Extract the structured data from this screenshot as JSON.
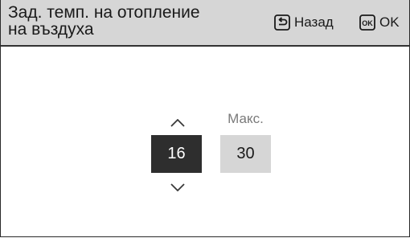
{
  "header": {
    "title_line1": "Зад. темп. на отопление",
    "title_line2": "на въздуха",
    "back_label": "Назад",
    "ok_label": "OK",
    "back_icon": "back-return-icon",
    "ok_icon": "ok-key-icon"
  },
  "setpoint": {
    "min_value": "16",
    "max_label": "Макс.",
    "max_value": "30",
    "up_icon": "chevron-up-icon",
    "down_icon": "chevron-down-icon"
  },
  "colors": {
    "header_bg": "#d6d6d6",
    "selected_bg": "#2e2e2e",
    "inactive_bg": "#d6d6d6",
    "label_gray": "#7a7a7a"
  }
}
